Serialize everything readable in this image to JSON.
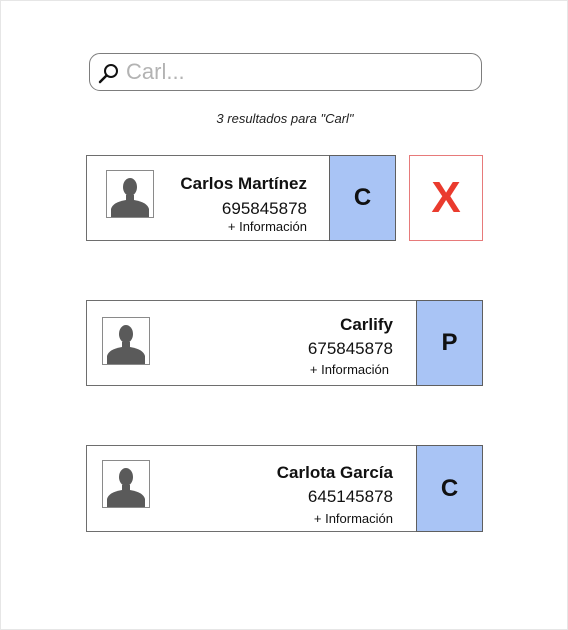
{
  "search": {
    "value": "",
    "placeholder": "Carl..."
  },
  "results_text": "3 resultados para \"Carl\"",
  "contacts": [
    {
      "name": "Carlos Martínez",
      "phone": "695845878",
      "more": "+ Información",
      "letter": "C"
    },
    {
      "name": "Carlify",
      "phone": "675845878",
      "more": "+ Información",
      "letter": "P"
    },
    {
      "name": "Carlota García",
      "phone": "645145878",
      "more": "+ Información",
      "letter": "C"
    }
  ],
  "delete_label": "X",
  "colors": {
    "letter_bg": "#a9c4f5",
    "delete": "#ea3b2e",
    "avatar": "#5a5a5a"
  }
}
